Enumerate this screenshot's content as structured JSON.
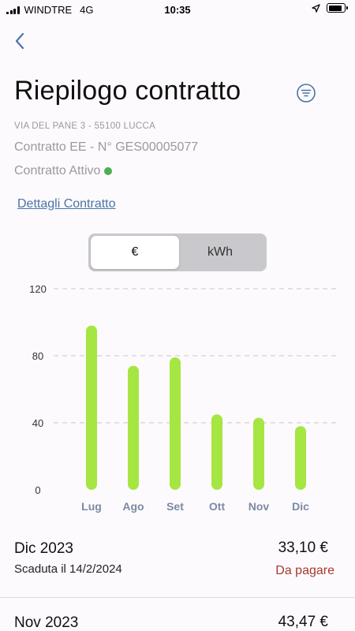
{
  "status_bar": {
    "carrier": "WINDTRE",
    "network": "4G",
    "time": "10:35",
    "battery_level": 0.85
  },
  "header": {
    "back_icon": "chevron-left-icon",
    "title": "Riepilogo contratto",
    "filter_icon": "filter-list-icon"
  },
  "contract": {
    "address": "VIA DEL PANE 3 - 55100 LUCCA",
    "number": "Contratto EE - N° GES00005077",
    "status": "Contratto Attivo",
    "status_color": "#4caf50",
    "details_link": "Dettagli Contratto"
  },
  "toggle": {
    "options": [
      "€",
      "kWh"
    ],
    "selected": "€"
  },
  "chart_data": {
    "type": "bar",
    "categories": [
      "Lug",
      "Ago",
      "Set",
      "Ott",
      "Nov",
      "Dic"
    ],
    "values": [
      98,
      74,
      79,
      45,
      43,
      38
    ],
    "yticks": [
      "0",
      "40",
      "80",
      "120"
    ],
    "ylim": [
      0,
      120
    ],
    "grid": true,
    "bar_color": "#a5e642"
  },
  "bills": [
    {
      "month": "Dic 2023",
      "amount": "33,10 €",
      "due": "Scaduta il 14/2/2024",
      "status": "Da pagare"
    },
    {
      "month": "Nov 2023",
      "amount": "43,47 €"
    }
  ]
}
